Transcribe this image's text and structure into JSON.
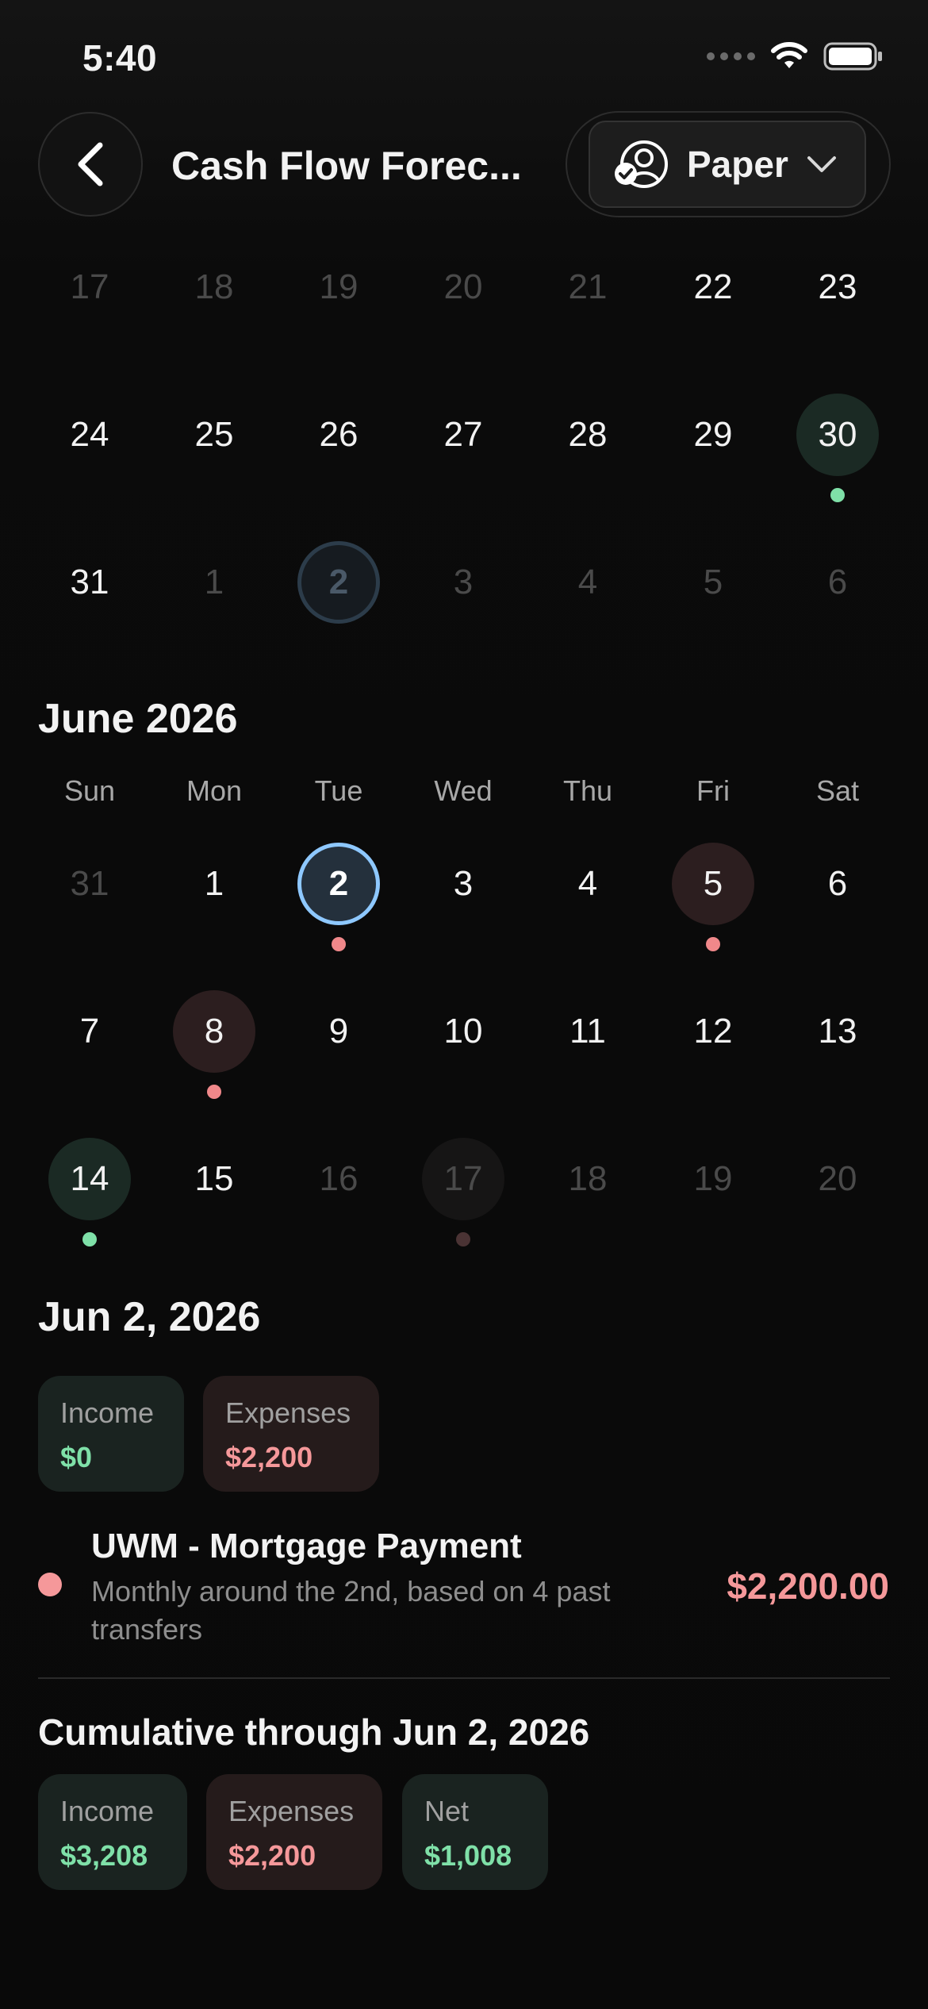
{
  "status_bar": {
    "time": "5:40"
  },
  "header": {
    "title": "Cash Flow Forec...",
    "account_label": "Paper"
  },
  "calendar_prev": {
    "rows": [
      [
        {
          "day": "17",
          "dim": true
        },
        {
          "day": "18",
          "dim": true
        },
        {
          "day": "19",
          "dim": true
        },
        {
          "day": "20",
          "dim": true
        },
        {
          "day": "21",
          "dim": true
        },
        {
          "day": "22"
        },
        {
          "day": "23"
        }
      ],
      [
        {
          "day": "24"
        },
        {
          "day": "25"
        },
        {
          "day": "26"
        },
        {
          "day": "27"
        },
        {
          "day": "28"
        },
        {
          "day": "29"
        },
        {
          "day": "30",
          "style": "green",
          "dot": "green"
        }
      ],
      [
        {
          "day": "31"
        },
        {
          "day": "1",
          "dim": true
        },
        {
          "day": "2",
          "style": "ring-dim"
        },
        {
          "day": "3",
          "dim": true
        },
        {
          "day": "4",
          "dim": true
        },
        {
          "day": "5",
          "dim": true
        },
        {
          "day": "6",
          "dim": true
        }
      ]
    ]
  },
  "calendar_june": {
    "title": "June 2026",
    "weekdays": [
      "Sun",
      "Mon",
      "Tue",
      "Wed",
      "Thu",
      "Fri",
      "Sat"
    ],
    "rows": [
      [
        {
          "day": "31",
          "dim": true
        },
        {
          "day": "1"
        },
        {
          "day": "2",
          "style": "ring-bright",
          "dot": "red"
        },
        {
          "day": "3"
        },
        {
          "day": "4"
        },
        {
          "day": "5",
          "style": "red",
          "dot": "red"
        },
        {
          "day": "6"
        }
      ],
      [
        {
          "day": "7"
        },
        {
          "day": "8",
          "style": "red",
          "dot": "red"
        },
        {
          "day": "9"
        },
        {
          "day": "10"
        },
        {
          "day": "11"
        },
        {
          "day": "12"
        },
        {
          "day": "13"
        }
      ],
      [
        {
          "day": "14",
          "style": "green",
          "dot": "green"
        },
        {
          "day": "15"
        },
        {
          "day": "16",
          "dim": true
        },
        {
          "day": "17",
          "dim": true,
          "style": "faint",
          "dot": "faint"
        },
        {
          "day": "18",
          "dim": true
        },
        {
          "day": "19",
          "dim": true
        },
        {
          "day": "20",
          "dim": true
        }
      ]
    ]
  },
  "day_detail": {
    "title": "Jun 2, 2026",
    "income_label": "Income",
    "income_value": "$0",
    "expenses_label": "Expenses",
    "expenses_value": "$2,200",
    "transaction": {
      "title": "UWM - Mortgage Payment",
      "subtitle": "Monthly around the 2nd, based on 4 past transfers",
      "amount": "$2,200.00"
    }
  },
  "cumulative": {
    "title": "Cumulative through Jun 2, 2026",
    "income_label": "Income",
    "income_value": "$3,208",
    "expenses_label": "Expenses",
    "expenses_value": "$2,200",
    "net_label": "Net",
    "net_value": "$1,008"
  },
  "colors": {
    "income": "#7fe0a8",
    "expense": "#f5989a",
    "selected_ring": "#8ec8ff"
  }
}
